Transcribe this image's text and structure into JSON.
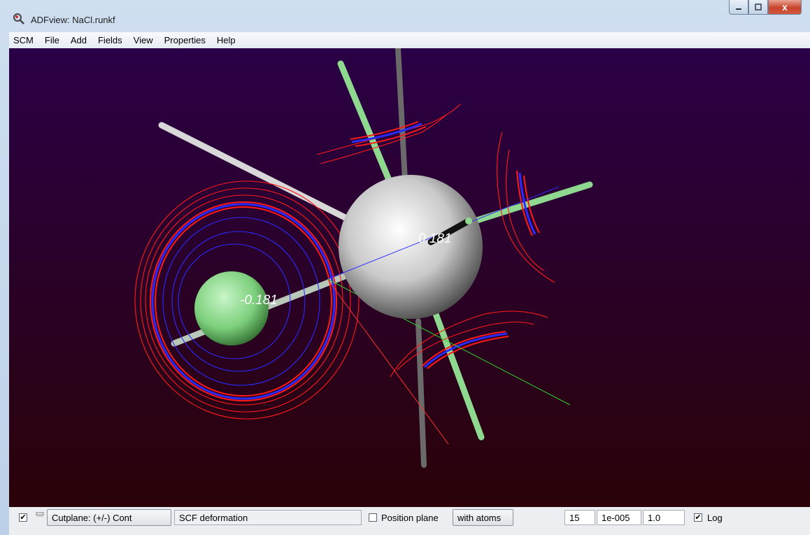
{
  "window": {
    "title": "ADFview: NaCl.runkf",
    "buttons": {
      "close_label": "x"
    }
  },
  "menu": {
    "items": [
      "SCM",
      "File",
      "Add",
      "Fields",
      "View",
      "Properties",
      "Help"
    ]
  },
  "viewport": {
    "atom_labels": {
      "na": "0.181",
      "cl": "-0.181"
    },
    "colors": {
      "background_top": "#2a0046",
      "background_bottom": "#2a0208",
      "positive_contour": "#ff1a1a",
      "negative_contour": "#2b2bff",
      "na_atom": "#f0f0f0",
      "cl_atom": "#8fd88f",
      "axis_x": "#ff3030",
      "axis_y": "#30d030",
      "axis_z": "#3030ff"
    }
  },
  "status": {
    "cutplane_checkbox_checked": true,
    "second_checkbox_checked": false,
    "cutplane_label": "Cutplane: (+/-) Cont",
    "field_name": "SCF deformation",
    "position_plane_checked": false,
    "position_plane_label": "Position plane",
    "with_atoms_label": "with atoms",
    "contour_count": "15",
    "contour_min": "1e-005",
    "contour_scale": "1.0",
    "log_checked": true,
    "log_label": "Log"
  }
}
